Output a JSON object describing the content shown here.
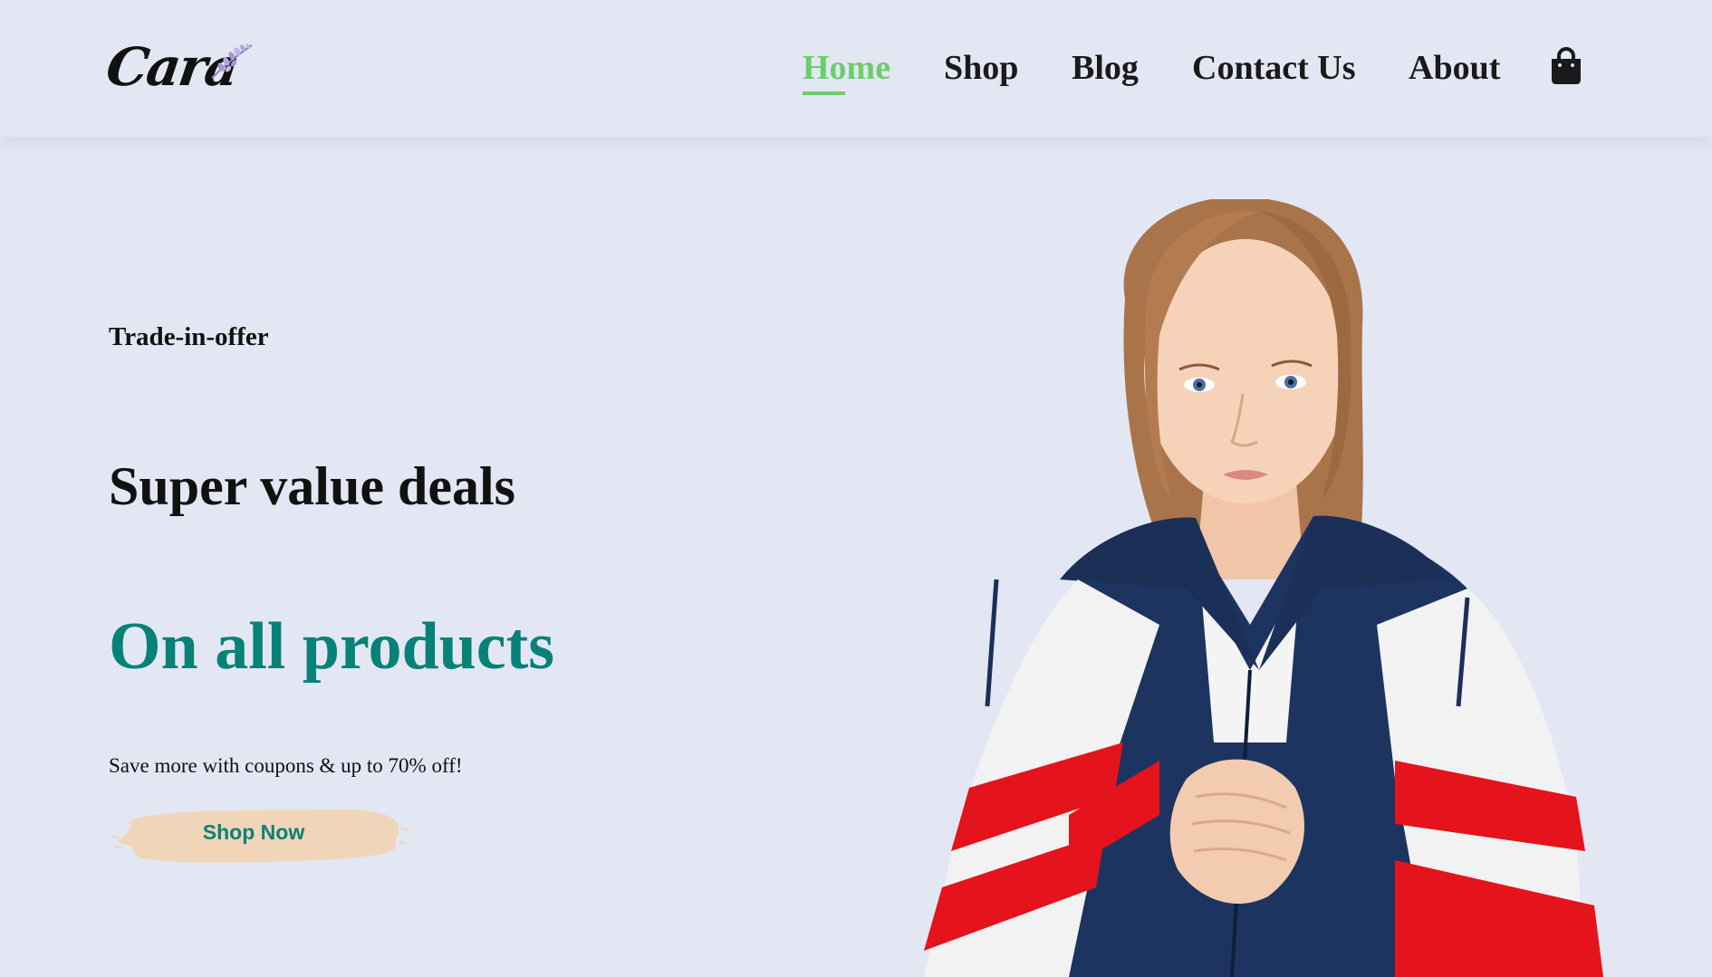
{
  "header": {
    "logo_text": "Cara",
    "nav": [
      {
        "label": "Home",
        "active": true
      },
      {
        "label": "Shop",
        "active": false
      },
      {
        "label": "Blog",
        "active": false
      },
      {
        "label": "Contact Us",
        "active": false
      },
      {
        "label": "About",
        "active": false
      }
    ],
    "cart_icon": "shopping-bag-icon"
  },
  "hero": {
    "kicker": "Trade-in-offer",
    "headline": "Super value deals",
    "subhead": "On all products",
    "tagline": "Save more with coupons & up to 70% off!",
    "button_label": "Shop Now",
    "image": "woman-in-windbreaker-jacket"
  },
  "colors": {
    "background": "#e3e6f3",
    "accent_green": "#6cce6a",
    "brand_teal": "#088178",
    "button_brush": "#f0d5b8",
    "jacket_navy": "#1d3461",
    "jacket_red": "#e4131c"
  }
}
